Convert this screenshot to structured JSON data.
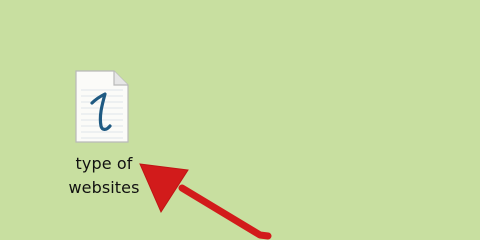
{
  "desktop": {
    "background_color": "#c8dfa0",
    "file": {
      "icon": "text-document-icon",
      "glyph": "1",
      "label_line1": "type of",
      "label_line2": "websites"
    },
    "annotation": {
      "icon": "red-arrow-pointer",
      "color": "#d01818"
    }
  }
}
